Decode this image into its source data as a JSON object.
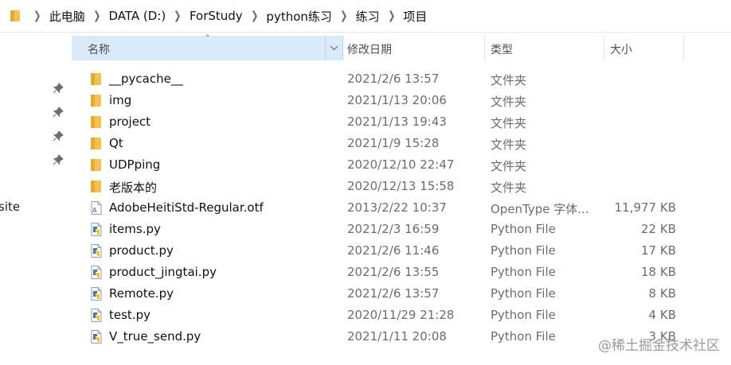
{
  "breadcrumb": {
    "items": [
      "此电脑",
      "DATA (D:)",
      "ForStudy",
      "python练习",
      "练习",
      "项目"
    ]
  },
  "nav": {
    "partial_label": "site"
  },
  "columns": {
    "name": "名称",
    "date": "修改日期",
    "type": "类型",
    "size": "大小"
  },
  "files": [
    {
      "name": "__pycache__",
      "date": "2021/2/6 13:57",
      "type": "文件夹",
      "size": "",
      "icon": "folder-icon"
    },
    {
      "name": "img",
      "date": "2021/1/13 20:06",
      "type": "文件夹",
      "size": "",
      "icon": "folder-icon"
    },
    {
      "name": "project",
      "date": "2021/1/13 19:43",
      "type": "文件夹",
      "size": "",
      "icon": "folder-icon"
    },
    {
      "name": "Qt",
      "date": "2021/1/9 15:28",
      "type": "文件夹",
      "size": "",
      "icon": "folder-icon"
    },
    {
      "name": "UDPping",
      "date": "2020/12/10 22:47",
      "type": "文件夹",
      "size": "",
      "icon": "folder-icon"
    },
    {
      "name": "老版本的",
      "date": "2020/12/13 15:58",
      "type": "文件夹",
      "size": "",
      "icon": "folder-icon"
    },
    {
      "name": "AdobeHeitiStd-Regular.otf",
      "date": "2013/2/22 10:37",
      "type": "OpenType 字体...",
      "size": "11,977 KB",
      "icon": "font-file-icon"
    },
    {
      "name": "items.py",
      "date": "2021/2/3 16:59",
      "type": "Python File",
      "size": "22 KB",
      "icon": "python-file-icon"
    },
    {
      "name": "product.py",
      "date": "2021/2/6 11:46",
      "type": "Python File",
      "size": "17 KB",
      "icon": "python-file-icon"
    },
    {
      "name": "product_jingtai.py",
      "date": "2021/2/6 13:55",
      "type": "Python File",
      "size": "18 KB",
      "icon": "python-file-icon"
    },
    {
      "name": "Remote.py",
      "date": "2021/2/6 13:57",
      "type": "Python File",
      "size": "8 KB",
      "icon": "python-file-icon"
    },
    {
      "name": "test.py",
      "date": "2020/11/29 21:28",
      "type": "Python File",
      "size": "4 KB",
      "icon": "python-file-icon"
    },
    {
      "name": "V_true_send.py",
      "date": "2021/1/11 20:08",
      "type": "Python File",
      "size": "3 KB",
      "icon": "python-file-icon"
    }
  ],
  "watermark": "@稀土掘金技术社区",
  "colors": {
    "header_selected": "#d9eaf9",
    "folder": "#f4c253",
    "python_blue": "#3d7ab8",
    "python_yellow": "#f2c230"
  }
}
